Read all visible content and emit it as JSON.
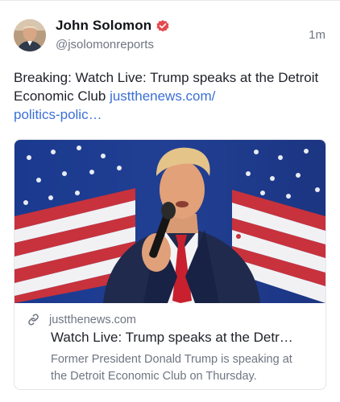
{
  "post": {
    "author": {
      "display_name": "John Solomon",
      "handle": "@jsolomonreports",
      "verified": true,
      "avatar_icon": "avatar-photo"
    },
    "timestamp": "1m",
    "text_plain": "Breaking: Watch Live: Trump speaks at the Detroit Economic Club ",
    "text_link": "justthenews.com/politics-polic…",
    "text_link_line1": "justthenews.com/",
    "text_link_line2": "politics-polic…"
  },
  "link_card": {
    "domain": "justthenews.com",
    "title": "Watch Live: Trump speaks at the Detr…",
    "description": "Former President Donald Trump is speaking at the Detroit Economic Club on Thursday.",
    "link_icon": "link-icon",
    "image_icon": "link-preview-image"
  },
  "colors": {
    "link": "#3b6fd6",
    "verified_badge": "#e5484d",
    "muted_text": "#6f7582"
  }
}
